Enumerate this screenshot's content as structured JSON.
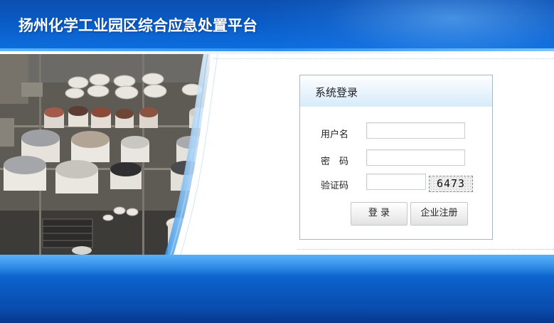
{
  "header": {
    "title": "扬州化学工业园区综合应急处置平台"
  },
  "login": {
    "title": "系统登录",
    "username_label": "用户名",
    "username_value": "",
    "password_label": "密　码",
    "password_value": "",
    "captcha_label": "验证码",
    "captcha_value": "",
    "captcha_image_text": "6473",
    "login_button": "登 录",
    "register_button": "企业注册"
  },
  "colors": {
    "header_blue": "#0a5cc6",
    "footer_blue": "#0c62cc",
    "panel_border": "#a9b8c6",
    "panel_head": "#d7ebfa"
  }
}
